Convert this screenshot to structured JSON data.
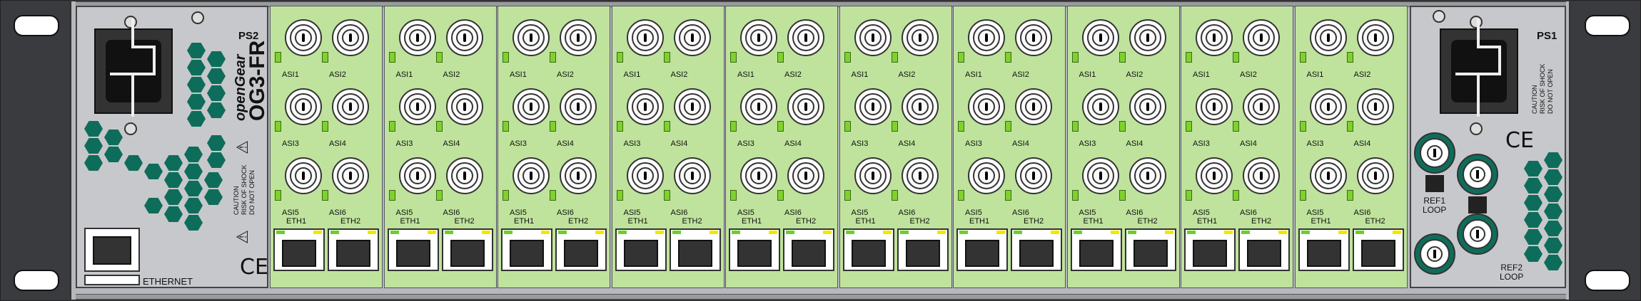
{
  "power_supplies": {
    "left": {
      "label": "PS2",
      "caution": [
        "CAUTION",
        "RISK OF SHOCK",
        "DO NOT OPEN"
      ]
    },
    "right": {
      "label": "PS1",
      "caution": [
        "CAUTION",
        "RISK OF SHOCK",
        "DO NOT OPEN"
      ]
    }
  },
  "brand": {
    "logo": "openGear",
    "model": "OG3-FR"
  },
  "ethernet_label": "ETHERNET",
  "ce_mark": "CE",
  "warning_glyph": "⚠",
  "cards": [
    {
      "bnc": [
        "ASI1",
        "ASI2",
        "ASI3",
        "ASI4",
        "ASI5",
        "ASI6"
      ],
      "eth": [
        "ETH1",
        "ETH2"
      ]
    },
    {
      "bnc": [
        "ASI1",
        "ASI2",
        "ASI3",
        "ASI4",
        "ASI5",
        "ASI6"
      ],
      "eth": [
        "ETH1",
        "ETH2"
      ]
    },
    {
      "bnc": [
        "ASI1",
        "ASI2",
        "ASI3",
        "ASI4",
        "ASI5",
        "ASI6"
      ],
      "eth": [
        "ETH1",
        "ETH2"
      ]
    },
    {
      "bnc": [
        "ASI1",
        "ASI2",
        "ASI3",
        "ASI4",
        "ASI5",
        "ASI6"
      ],
      "eth": [
        "ETH1",
        "ETH2"
      ]
    },
    {
      "bnc": [
        "ASI1",
        "ASI2",
        "ASI3",
        "ASI4",
        "ASI5",
        "ASI6"
      ],
      "eth": [
        "ETH1",
        "ETH2"
      ]
    },
    {
      "bnc": [
        "ASI1",
        "ASI2",
        "ASI3",
        "ASI4",
        "ASI5",
        "ASI6"
      ],
      "eth": [
        "ETH1",
        "ETH2"
      ]
    },
    {
      "bnc": [
        "ASI1",
        "ASI2",
        "ASI3",
        "ASI4",
        "ASI5",
        "ASI6"
      ],
      "eth": [
        "ETH1",
        "ETH2"
      ]
    },
    {
      "bnc": [
        "ASI1",
        "ASI2",
        "ASI3",
        "ASI4",
        "ASI5",
        "ASI6"
      ],
      "eth": [
        "ETH1",
        "ETH2"
      ]
    },
    {
      "bnc": [
        "ASI1",
        "ASI2",
        "ASI3",
        "ASI4",
        "ASI5",
        "ASI6"
      ],
      "eth": [
        "ETH1",
        "ETH2"
      ]
    },
    {
      "bnc": [
        "ASI1",
        "ASI2",
        "ASI3",
        "ASI4",
        "ASI5",
        "ASI6"
      ],
      "eth": [
        "ETH1",
        "ETH2"
      ]
    }
  ],
  "ref_loops": [
    {
      "label_line1": "REF1",
      "label_line2": "LOOP"
    },
    {
      "label_line1": "REF2",
      "label_line2": "LOOP"
    }
  ],
  "colors": {
    "card_green": "#bfe39c",
    "hex_green": "#0e6d5a",
    "chassis": "#b7b8bb",
    "led_green": "#7fd12e",
    "led_yellow": "#f5e600"
  }
}
